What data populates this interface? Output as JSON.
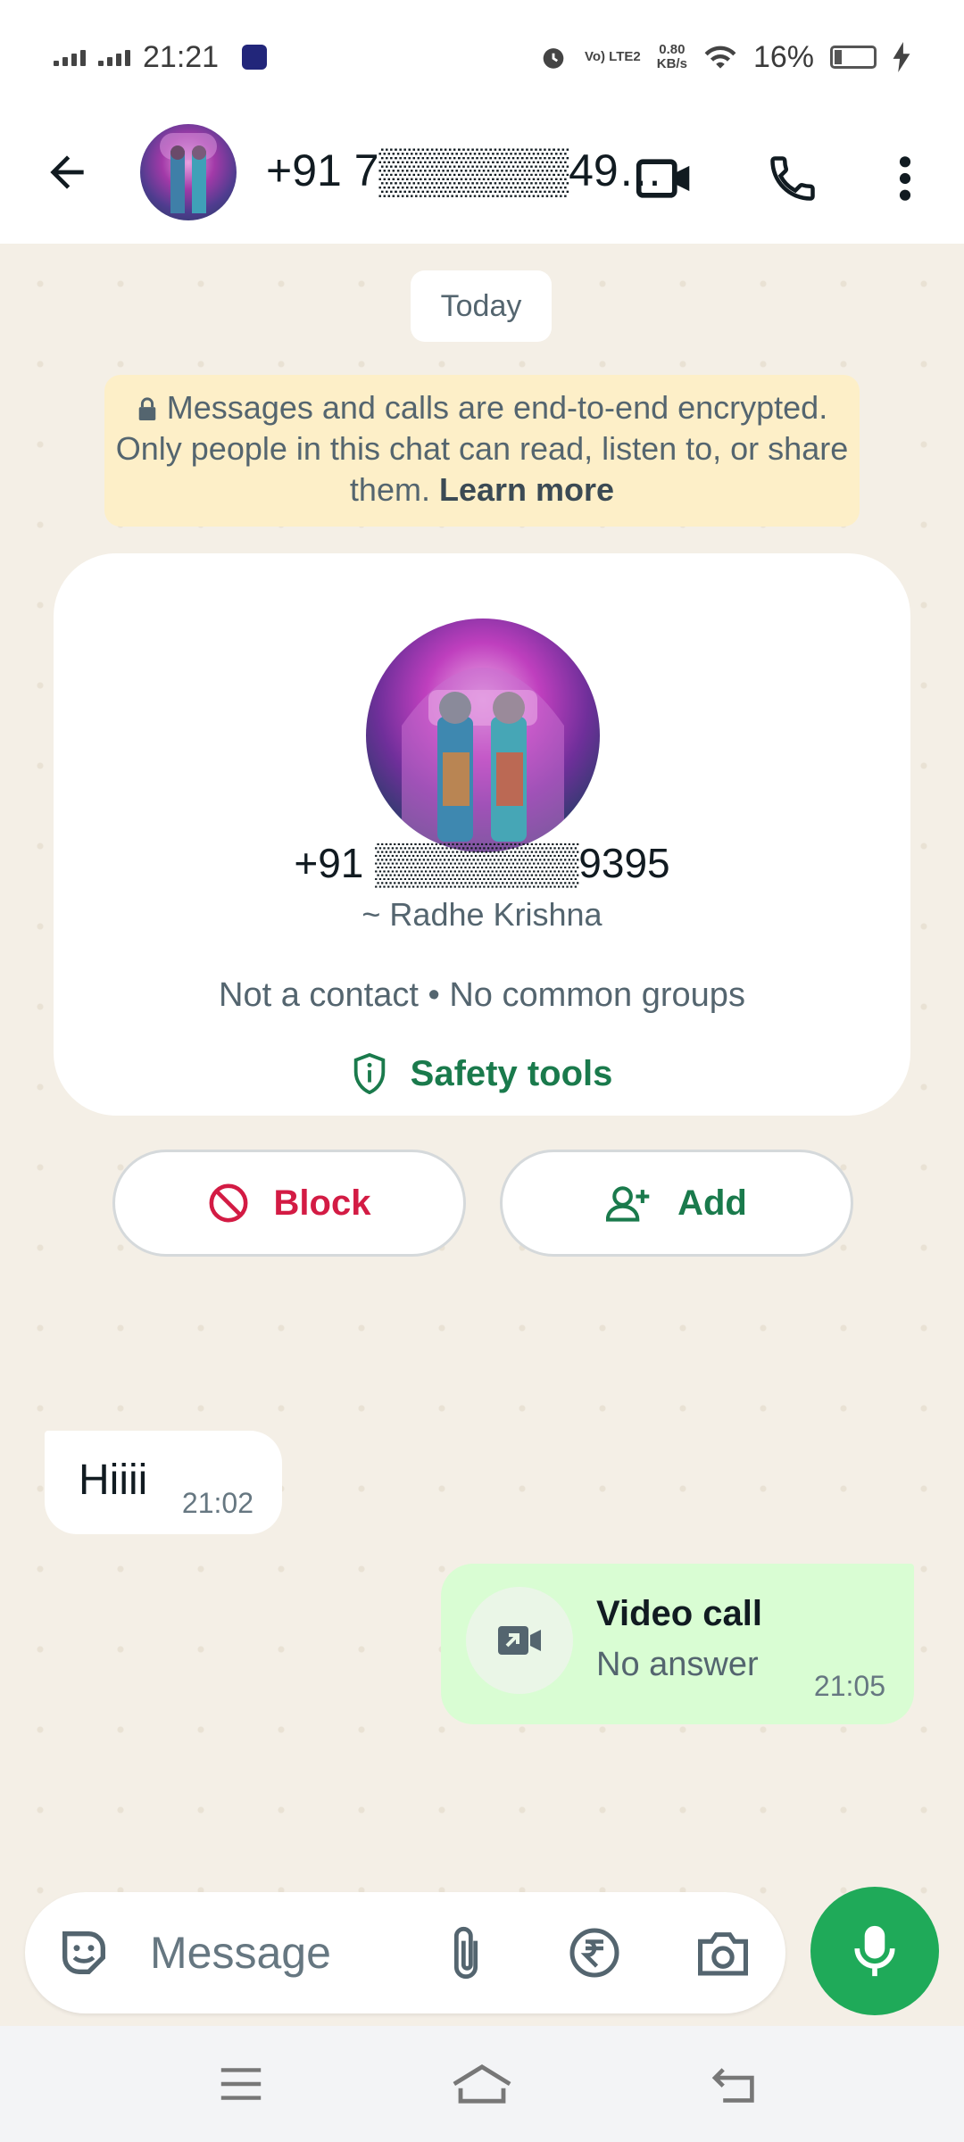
{
  "status_bar": {
    "time": "21:21",
    "network": "Vo) LTE2",
    "speed_value": "0.80",
    "speed_unit": "KB/s",
    "battery": "16%"
  },
  "header": {
    "contact_name": "+91 7▒▒▒▒▒▒49…",
    "icons": [
      "back-arrow-icon",
      "video-call-icon",
      "phone-icon",
      "more-vert-icon"
    ]
  },
  "chat": {
    "date_chip": "Today",
    "encryption_text": "Messages and calls are end-to-end encrypted. Only people in this chat can read, listen to, or share them.",
    "encryption_link": "Learn more",
    "contact_card": {
      "phone": "+91 ▒▒▒▒▒▒▒9395",
      "display_name": "~ Radhe Krishna",
      "info": "Not a contact • No common groups",
      "safety_label": "Safety tools",
      "block_label": "Block",
      "add_label": "Add"
    },
    "messages": [
      {
        "direction": "incoming",
        "text": "Hiiii",
        "time": "21:02"
      },
      {
        "direction": "outgoing",
        "type": "call",
        "title": "Video call",
        "subtitle": "No answer",
        "time": "21:05"
      }
    ]
  },
  "composer": {
    "placeholder": "Message"
  },
  "colors": {
    "accent_green": "#1faa59",
    "block_red": "#d31b44",
    "encryption_bg": "#fdefc8",
    "outgoing_bubble": "#d9fdd3",
    "chat_bg": "#f4efe6"
  }
}
